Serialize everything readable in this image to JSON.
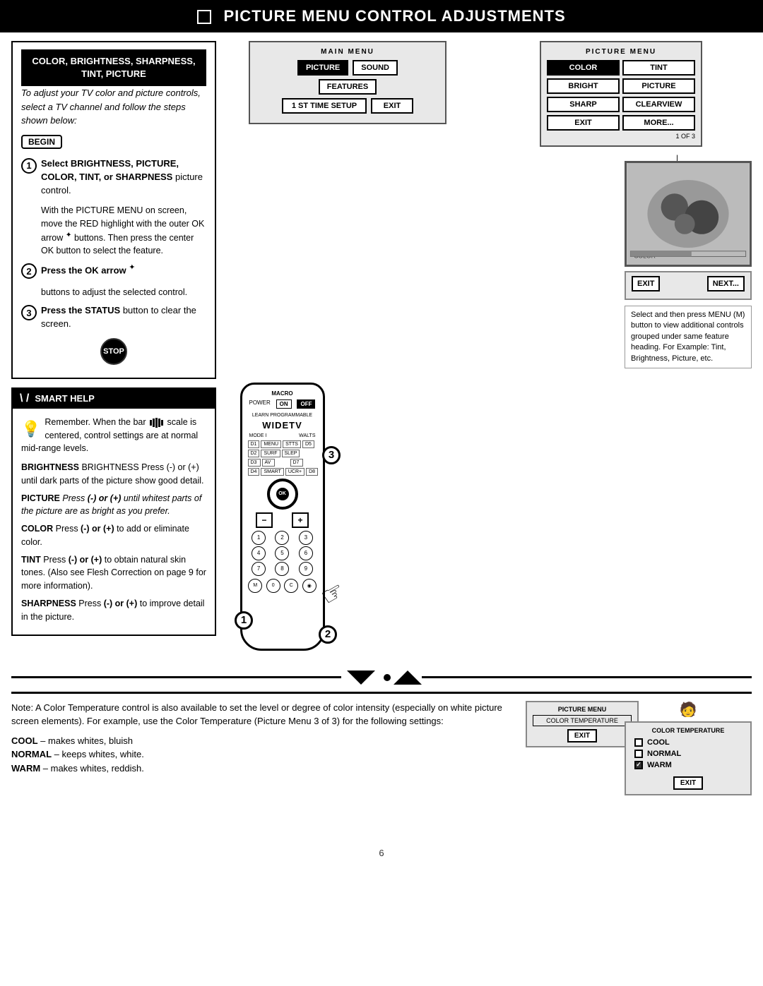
{
  "page": {
    "title": "Picture Menu Control Adjustments",
    "page_number": "6"
  },
  "header": {
    "title": "PICTURE MENU CONTROL ADJUSTMENTS"
  },
  "section1": {
    "header": "COLOR, BRIGHTNESS, SHARPNESS, TINT, PICTURE",
    "intro": "To adjust your TV color and picture controls, select a TV channel and follow the steps shown below:",
    "begin_label": "BEGIN",
    "step1_label": "Select BRIGHTNESS, PICTURE, COLOR, TINT, or SHARPNESS picture control.",
    "step1_detail": "With the PICTURE MENU on screen, move the RED highlight with the outer OK arrow",
    "step1_detail2": "buttons. Then press the center OK button to select the feature.",
    "step2_label": "Press the OK arrow",
    "step2_detail": "buttons to adjust the selected control.",
    "step3_label": "Press the STATUS button to clear the screen.",
    "stop_label": "STOP"
  },
  "smart_help": {
    "header": "SMART HELP",
    "text": "Remember. When the bar scale is centered, control settings are at normal mid-range levels.",
    "brightness_desc": "BRIGHTNESS Press (-) or (+) until dark parts of the picture show good detail.",
    "picture_desc": "PICTURE Press (-) or (+) until whitest parts of the picture are as bright as you prefer.",
    "color_desc": "COLOR Press (-) or (+) to add or eliminate color.",
    "tint_desc": "TINT Press (-) or (+) to obtain natural skin tones. (Also see Flesh Correction on page 9 for more information).",
    "sharpness_desc": "SHARPNESS Press (-) or (+) to improve detail in the picture."
  },
  "main_menu": {
    "label": "MAIN MENU",
    "buttons": [
      "PICTURE",
      "SOUND",
      "FEATURES",
      "1 ST TIME SETUP",
      "EXIT"
    ]
  },
  "picture_menu": {
    "label": "PICTURE MENU",
    "buttons": [
      "COLOR",
      "TINT",
      "BRIGHT",
      "PICTURE",
      "SHARP",
      "CLEARVIEW",
      "EXIT",
      "MORE..."
    ],
    "of_label": "1 OF 3"
  },
  "color_screen": {
    "label": "COLOR",
    "exit": "EXIT",
    "next": "NEXT..."
  },
  "bottom_note": {
    "text": "Note: A Color Temperature control is also available to set the level or degree of color intensity (especially on white picture screen elements). For example, use the Color Temperature (Picture Menu 3 of 3) for the following settings:",
    "cool_label": "COOL",
    "cool_desc": "– makes whites, bluish",
    "normal_label": "NORMAL",
    "normal_desc": "– keeps whites, white.",
    "warm_label": "WARM",
    "warm_desc": "– makes whites, reddish."
  },
  "color_temp_screens": {
    "outer_label": "PICTURE MENU",
    "outer_sub": "COLOR TEMPERATURE",
    "outer_exit": "EXIT",
    "inner_label": "COLOR TEMPERATURE",
    "inner_cool": "COOL",
    "inner_normal": "NORMAL",
    "inner_warm": "WARM",
    "inner_exit": "EXIT"
  },
  "side_note": {
    "text": "Select and then press MENU (M) button to view additional controls grouped under same feature heading. For Example: Tint, Brightness, Picture, etc."
  }
}
